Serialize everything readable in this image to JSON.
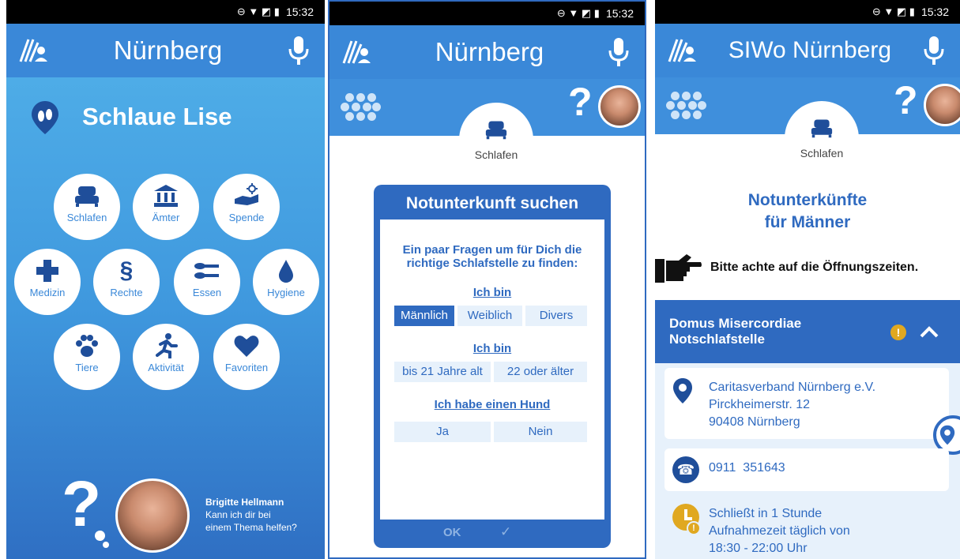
{
  "status": {
    "time": "15:32"
  },
  "screen1": {
    "app_title": "Nürnberg",
    "heading": "Schlaue Lise",
    "buttons": [
      "Schlafen",
      "Ämter",
      "Spende",
      "Medizin",
      "Rechte",
      "Essen",
      "Hygiene",
      "Tiere",
      "Aktivität",
      "Favoriten"
    ],
    "helper": {
      "name": "Brigitte Hellmann",
      "line1": "Kann ich dir bei",
      "line2": "einem Thema helfen?"
    }
  },
  "screen2": {
    "app_title": "Nürnberg",
    "tab_label": "Schlafen",
    "dialog": {
      "title": "Notunterkunft suchen",
      "intro_line1": "Ein paar Fragen um für Dich die",
      "intro_line2": "richtige Schlafstelle zu finden:",
      "q1": "Ich bin",
      "gender_options": [
        "Männlich",
        "Weiblich",
        "Divers"
      ],
      "q2": "Ich bin",
      "age_options": [
        "bis 21 Jahre alt",
        "22 oder älter"
      ],
      "q3": "Ich habe einen Hund",
      "dog_options": [
        "Ja",
        "Nein"
      ],
      "ok_label": "OK",
      "check_label": "✓"
    }
  },
  "screen3": {
    "app_title": "SIWo Nürnberg",
    "tab_label": "Schlafen",
    "heading_line1": "Notunterkünfte",
    "heading_line2": "für Männer",
    "hint": "Bitte achte auf die Öffnungszeiten.",
    "shelter": {
      "name_line1": "Domus Misercordiae",
      "name_line2": "Notschlafstelle",
      "address_line1": "Caritasverband Nürnberg e.V.",
      "address_line2": "Pirckheimerstr. 12",
      "address_line3": "90408 Nürnberg",
      "phone": "0911  351643",
      "hours_line1": "Schließt in 1 Stunde",
      "hours_line2": "Aufnahmezeit täglich von",
      "hours_line3": "18:30 - 22:00 Uhr"
    }
  },
  "colors": {
    "primary": "#2f6ac0",
    "appbar": "#3a88d8",
    "warning": "#e0a820",
    "light": "#e7f1fb"
  }
}
